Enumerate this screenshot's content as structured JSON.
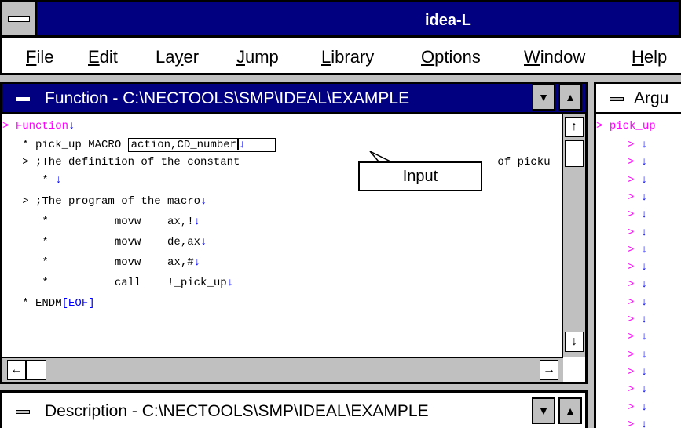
{
  "app": {
    "title": "idea-L"
  },
  "menu": {
    "file": {
      "mnemonic": "F",
      "rest": "ile"
    },
    "edit": {
      "mnemonic": "E",
      "rest": "dit"
    },
    "layer": {
      "pre": "La",
      "mnemonic": "y",
      "rest": "er"
    },
    "jump": {
      "mnemonic": "J",
      "rest": "ump"
    },
    "library": {
      "mnemonic": "L",
      "rest": "ibrary"
    },
    "options": {
      "mnemonic": "O",
      "rest": "ptions"
    },
    "window": {
      "mnemonic": "W",
      "rest": "indow"
    },
    "help": {
      "mnemonic": "H",
      "rest": "elp"
    }
  },
  "function_window": {
    "title": "Function - C:\\NECTOOLS\\SMP\\IDEAL\\EXAMPLE",
    "lines": {
      "l1_marker": "> ",
      "l1_text": "Function",
      "eol": "↓",
      "l2_prefix": "   * pick_up MACRO ",
      "l2_input": "action,CD_number",
      "l3_text": "   > ;The definition of the constant ",
      "l3_tail": " of picku",
      "l4_text": "      * ",
      "l5_text": "   > ;The program of the macro",
      "l6_text": "      *          movw    ax,!",
      "l7_text": "      *          movw    de,ax",
      "l8_text": "      *          movw    ax,#",
      "l9_text": "      *          call    !_pick_up",
      "l10_text": "   * ENDM",
      "l10_eof": "[EOF]"
    }
  },
  "callout": {
    "label": "Input"
  },
  "description_window": {
    "title": "Description - C:\\NECTOOLS\\SMP\\IDEAL\\EXAMPLE"
  },
  "argument_window": {
    "title": "Argu",
    "first_marker": "> ",
    "first_text": "pick_up",
    "row_marker": ">",
    "row_arrow": "↓"
  },
  "icons": {
    "system_menu": "minus-bar",
    "scroll_up": "↑",
    "scroll_down": "↓",
    "scroll_left": "←",
    "scroll_right": "→",
    "minimize": "▼",
    "maximize": "▲"
  },
  "colors": {
    "titlebar": "#000080",
    "marker": "#ff00ff",
    "eol": "#0000ff",
    "chrome": "#c0c0c0"
  }
}
